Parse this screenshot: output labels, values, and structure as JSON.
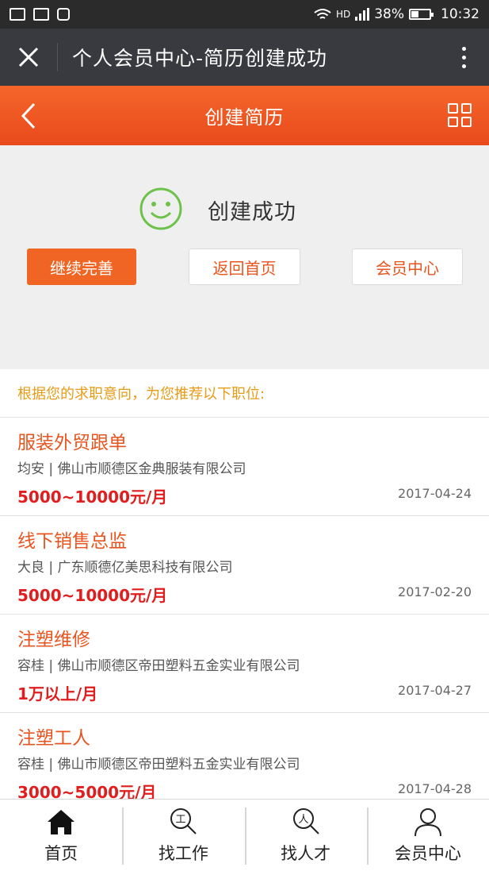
{
  "statusbar": {
    "left_icons": [
      "message-icon",
      "image-icon",
      "shield-icon"
    ],
    "network": "HD",
    "battery_percent": "38%",
    "battery_level": 0.38,
    "time": "10:32"
  },
  "wechat": {
    "close_icon": "close-icon",
    "title": "个人会员中心-简历创建成功",
    "more_icon": "more-vertical-icon"
  },
  "header": {
    "title": "创建简历",
    "back_icon": "chevron-left-icon",
    "grid_icon": "grid-icon"
  },
  "success": {
    "message": "创建成功",
    "icon": "smile-icon",
    "buttons": {
      "continue": "继续完善",
      "home": "返回首页",
      "member": "会员中心"
    }
  },
  "recommend": {
    "heading": "根据您的求职意向，为您推荐以下职位:",
    "jobs": [
      {
        "title": "服装外贸跟单",
        "company": "均安 | 佛山市顺德区金典服装有限公司",
        "salary": "5000~10000元/月",
        "date": "2017-04-24"
      },
      {
        "title": "线下销售总监",
        "company": "大良 | 广东顺德亿美思科技有限公司",
        "salary": "5000~10000元/月",
        "date": "2017-02-20"
      },
      {
        "title": "注塑维修",
        "company": "容桂 | 佛山市顺德区帝田塑料五金实业有限公司",
        "salary": "1万以上/月",
        "date": "2017-04-27"
      },
      {
        "title": "注塑工人",
        "company": "容桂 | 佛山市顺德区帝田塑料五金实业有限公司",
        "salary": "3000~5000元/月",
        "date": "2017-04-28"
      }
    ]
  },
  "tabbar": {
    "tabs": [
      {
        "label": "首页",
        "icon": "home-icon"
      },
      {
        "label": "找工作",
        "icon": "search-job-icon"
      },
      {
        "label": "找人才",
        "icon": "search-talent-icon"
      },
      {
        "label": "会员中心",
        "icon": "user-icon"
      }
    ]
  },
  "colors": {
    "accent": "#f06424",
    "salary": "#e11d1d",
    "tip": "#e89b16",
    "success_green": "#6cc24a"
  }
}
